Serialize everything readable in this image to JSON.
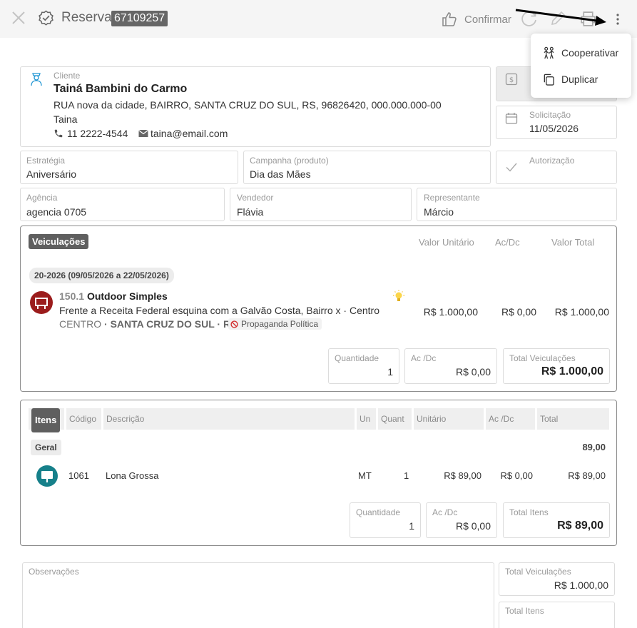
{
  "header": {
    "title": "Reserva",
    "id": "67109257",
    "confirm_label": "Confirmar"
  },
  "menu": {
    "items": [
      {
        "label": "Cooperativar",
        "icon": "people-icon"
      },
      {
        "label": "Duplicar",
        "icon": "copy-icon"
      }
    ]
  },
  "cliente": {
    "label": "Cliente",
    "name": "Tainá Bambini do Carmo",
    "address": "RUA nova da cidade, BAIRRO, SANTA CRUZ DO SUL, RS, 96826420, 000.000.000-00",
    "nickname": "Taina",
    "phone": "11 2222-4544",
    "email": "taina@email.com"
  },
  "solicitacao": {
    "label": "Solicitação",
    "value": "11/05/2026"
  },
  "estrategia": {
    "label": "Estratégia",
    "value": "Aniversário"
  },
  "campanha": {
    "label": "Campanha (produto)",
    "value": "Dia das Mães"
  },
  "autorizacao": {
    "label": "Autorização"
  },
  "agencia": {
    "label": "Agência",
    "value": "agencia 0705"
  },
  "vendedor": {
    "label": "Vendedor",
    "value": "Flávia"
  },
  "representante": {
    "label": "Representante",
    "value": "Márcio"
  },
  "veiculacoes": {
    "title": "Veiculações",
    "col_unit": "Valor Unitário",
    "col_acdc": "Ac/Dc",
    "col_total": "Valor Total",
    "period": "20-2026 (09/05/2026 a 22/05/2026)",
    "item": {
      "code": "150.1",
      "name": "Outdoor Simples",
      "location": "Frente a Receita Federal esquina com a Galvão Costa, Bairro x · Centro",
      "region": "CENTRO",
      "city": "· SANTA CRUZ DO SUL · RS",
      "tag": "Propaganda Política",
      "unit_value": "R$ 1.000,00",
      "acdc": "R$ 0,00",
      "total": "R$ 1.000,00"
    },
    "summary": {
      "qty_label": "Quantidade",
      "qty": "1",
      "acdc_label": "Ac /Dc",
      "acdc": "R$ 0,00",
      "total_label": "Total Veiculações",
      "total": "R$ 1.000,00"
    }
  },
  "itens": {
    "title": "Itens",
    "headers": [
      "Código",
      "Descrição",
      "Un",
      "Quant",
      "Unitário",
      "Ac /Dc",
      "Total"
    ],
    "group": "Geral",
    "group_total": "89,00",
    "row": {
      "code": "1061",
      "desc": "Lona Grossa",
      "un": "MT",
      "qty": "1",
      "unit": "R$ 89,00",
      "acdc": "R$ 0,00",
      "total": "R$ 89,00"
    },
    "summary": {
      "qty_label": "Quantidade",
      "qty": "1",
      "acdc_label": "Ac /Dc",
      "acdc": "R$ 0,00",
      "total_label": "Total Itens",
      "total": "R$ 89,00"
    }
  },
  "observacoes": {
    "label": "Observações"
  },
  "totais": {
    "veic_label": "Total Veiculações",
    "veic": "R$ 1.000,00",
    "itens_label": "Total Itens"
  },
  "colors": {
    "accent_red": "#9b1c1c",
    "accent_teal": "#16808a"
  }
}
